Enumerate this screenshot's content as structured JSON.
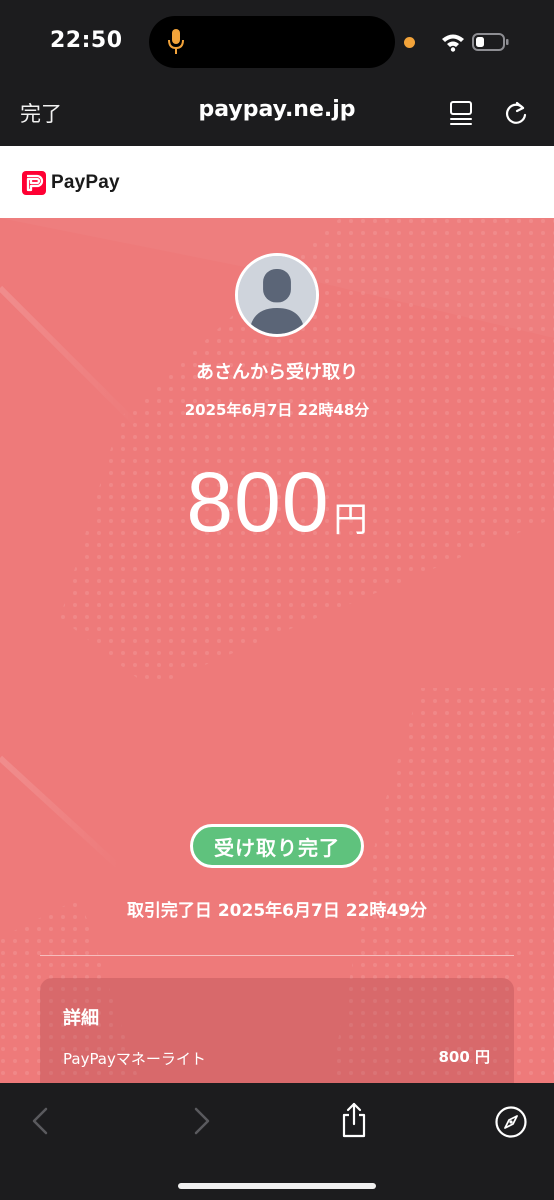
{
  "status_bar": {
    "time": "22:50"
  },
  "browser": {
    "done_label": "完了",
    "url": "paypay.ne.jp"
  },
  "site": {
    "logo_text": "PayPay"
  },
  "transaction": {
    "sender": "あさんから受け取り",
    "datetime": "2025年6月7日 22時48分",
    "amount": "800",
    "currency_unit": "円",
    "status": "受け取り完了",
    "completed_at": "取引完了日 2025年6月7日 22時49分"
  },
  "details": {
    "title": "詳細",
    "method": "PayPayマネーライト",
    "method_amount": "800 円"
  },
  "colors": {
    "main_background": "#ee7a7a",
    "status_badge": "#5fc27d",
    "logo_red": "#ff0033",
    "browser_chrome": "#1c1c1e"
  },
  "icons": [
    "mic-icon",
    "wifi-icon",
    "battery-icon",
    "reader-icon",
    "reload-icon",
    "paypay-logo-icon",
    "avatar-icon",
    "back-icon",
    "forward-icon",
    "share-icon",
    "compass-icon"
  ]
}
